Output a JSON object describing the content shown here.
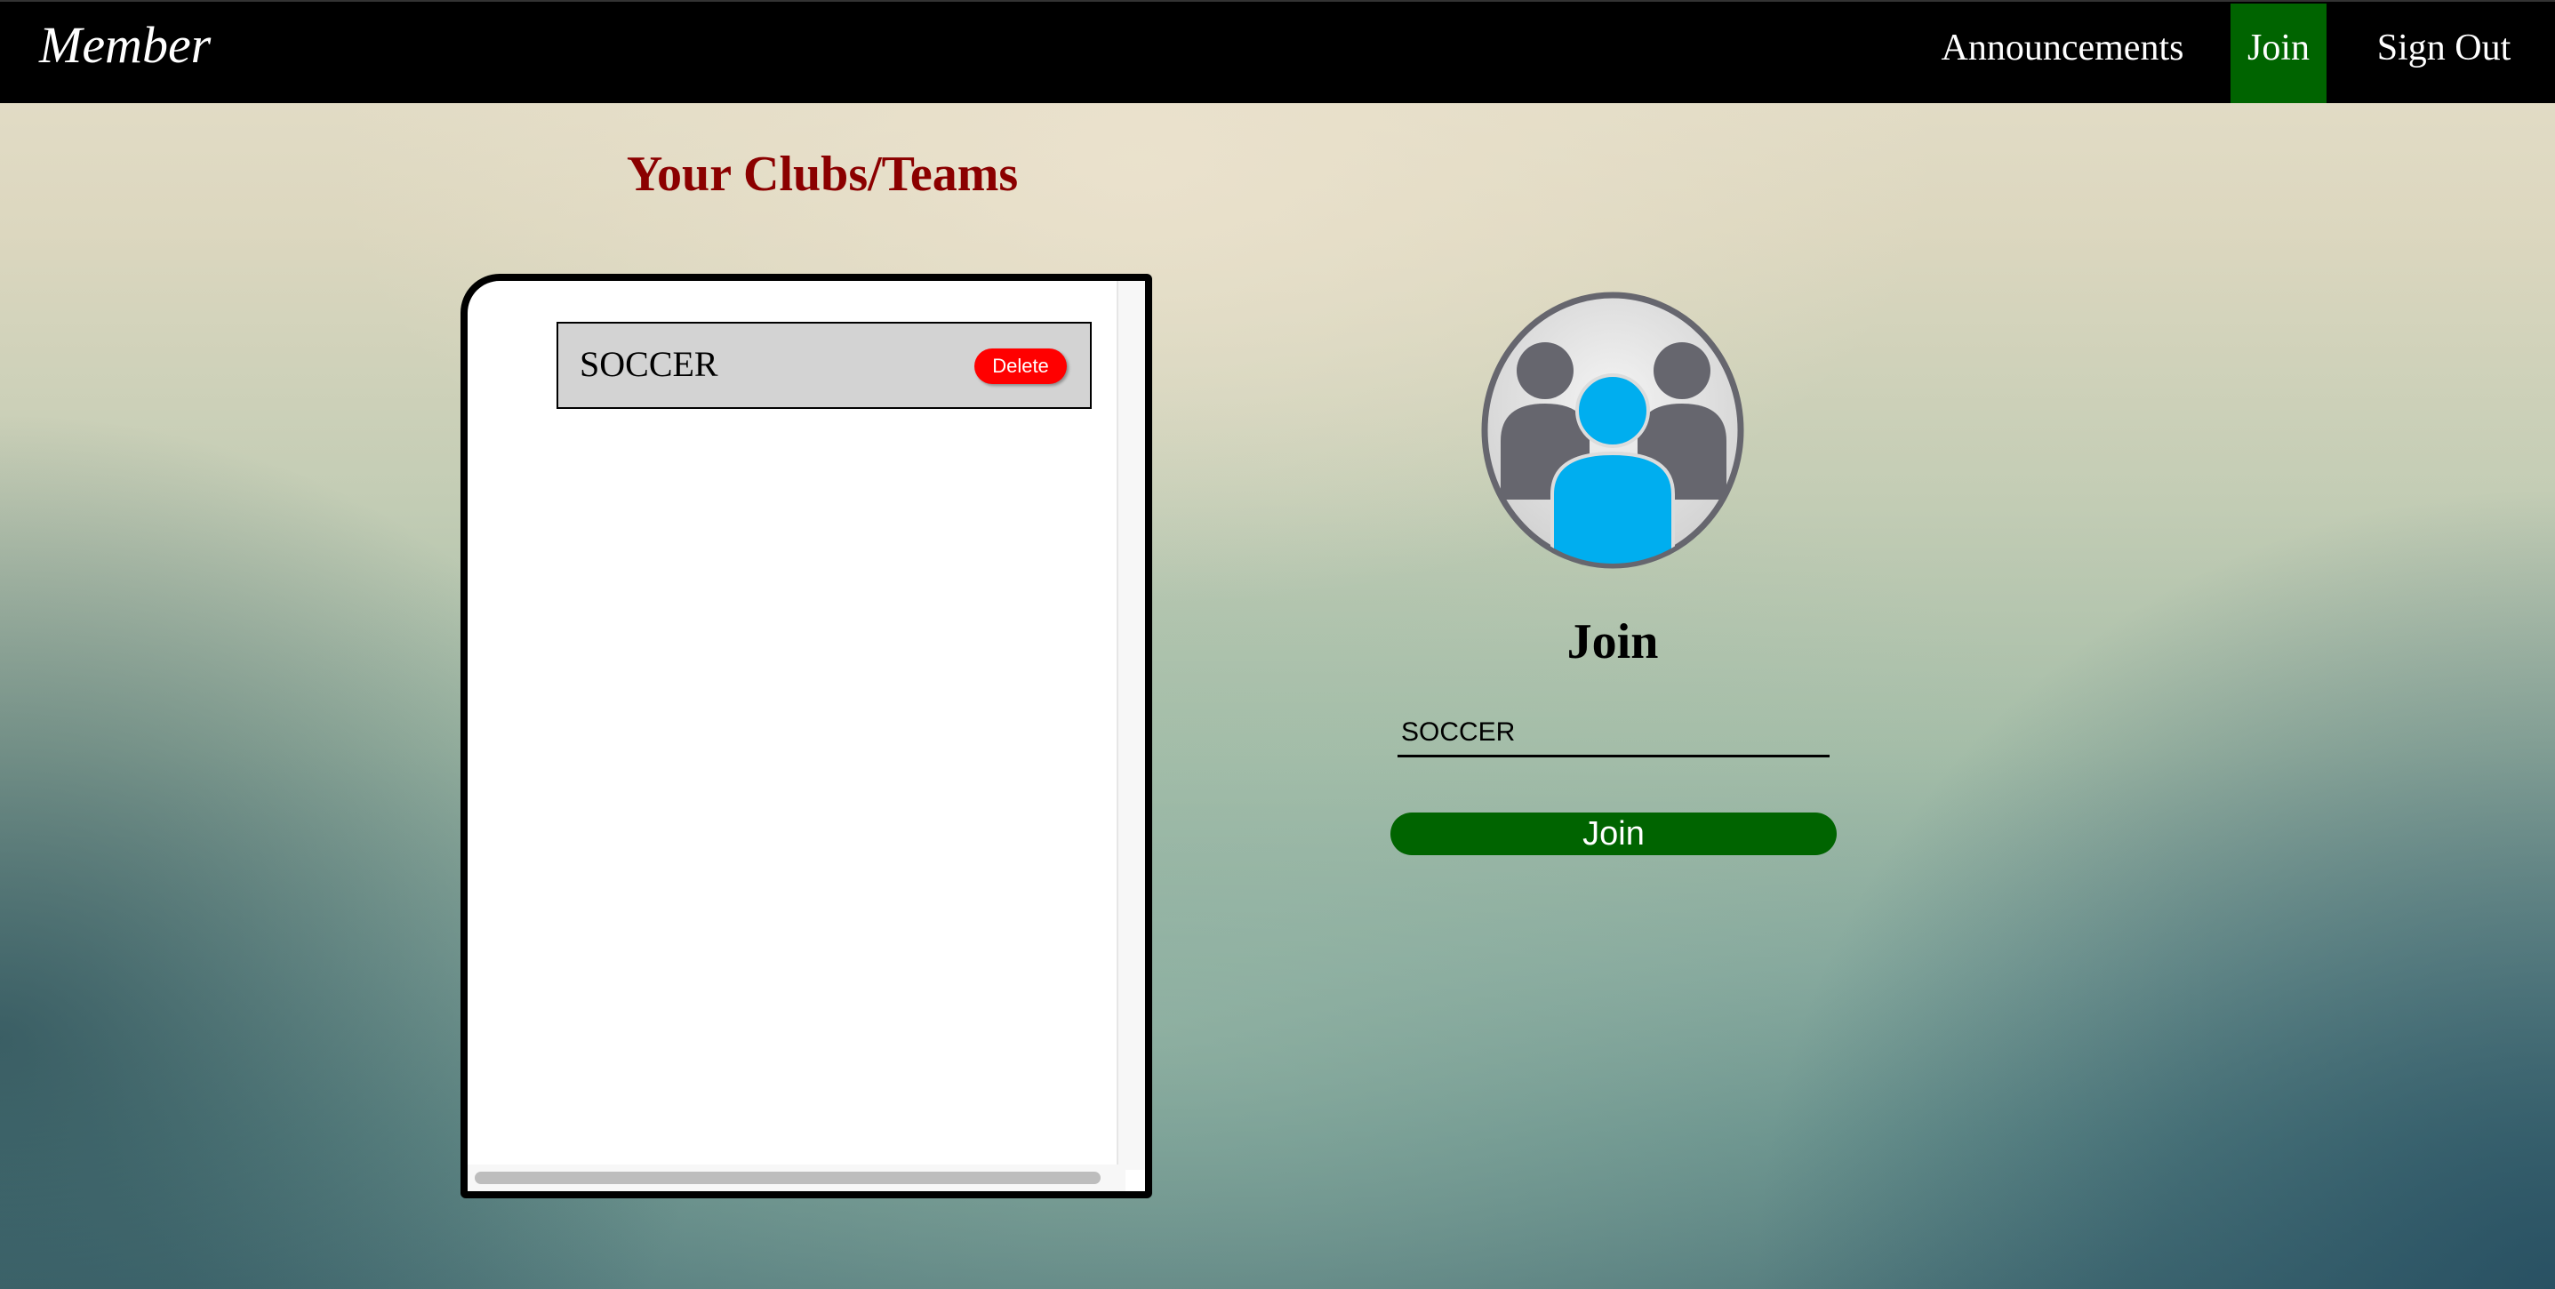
{
  "navbar": {
    "brand": "Member",
    "items": [
      {
        "label": "Announcements"
      },
      {
        "label": "Join",
        "active": true
      },
      {
        "label": "Sign Out"
      }
    ],
    "active_color": "#006400"
  },
  "clubs": {
    "title": "Your Clubs/Teams",
    "items": [
      {
        "name": "SOCCER",
        "action_label": "Delete"
      }
    ]
  },
  "join_panel": {
    "avatar_icon": "group-icon",
    "heading": "Join",
    "input_value": "SOCCER",
    "button_label": "Join"
  },
  "colors": {
    "title_red": "#8b0000",
    "delete_red": "#ff0000",
    "join_green": "#006400",
    "avatar_blue": "#00aeef",
    "avatar_gray": "#66666e"
  }
}
